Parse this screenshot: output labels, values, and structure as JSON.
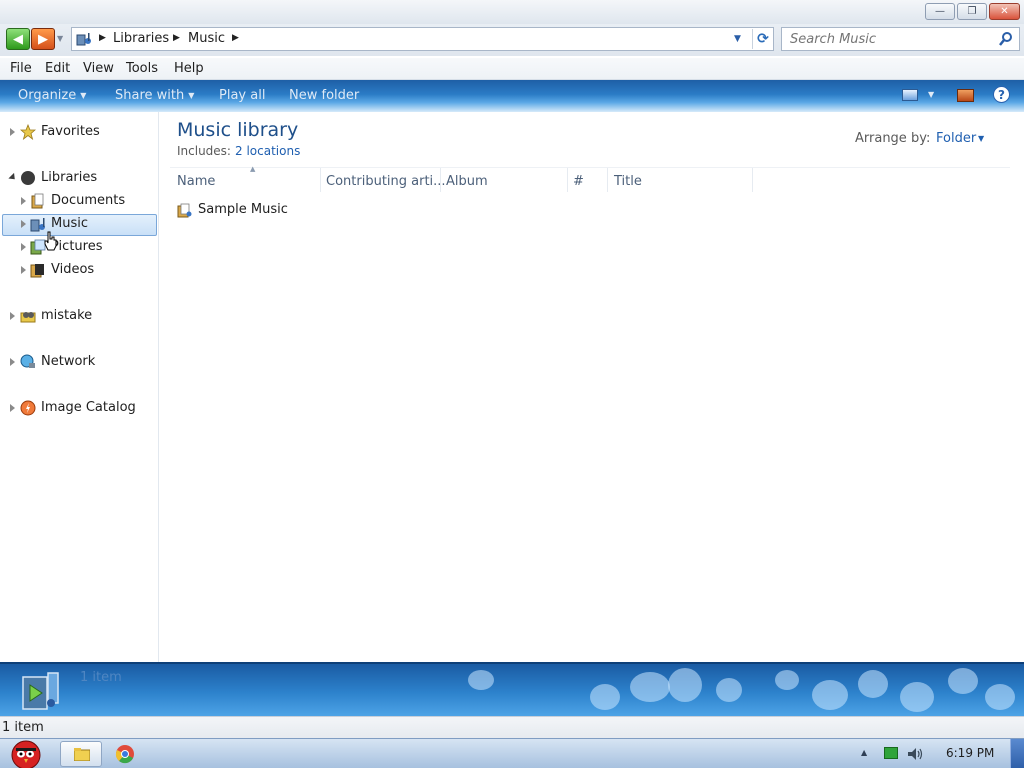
{
  "window": {
    "minimize_glyph": "—",
    "maximize_glyph": "❐",
    "close_glyph": "✕"
  },
  "address": {
    "back_glyph": "◀",
    "forward_glyph": "▶",
    "breadcrumbs": [
      "Libraries",
      "Music"
    ],
    "search_placeholder": "Search Music"
  },
  "menu": [
    "File",
    "Edit",
    "View",
    "Tools",
    "Help"
  ],
  "commandbar": {
    "organize": "Organize",
    "share_with": "Share with",
    "play_all": "Play all",
    "new_folder": "New folder",
    "help_glyph": "?"
  },
  "navpane": {
    "favorites": "Favorites",
    "libraries": "Libraries",
    "documents": "Documents",
    "music": "Music",
    "pictures": "Pictures",
    "videos": "Videos",
    "user": "mistake",
    "network": "Network",
    "image_catalog": "Image Catalog"
  },
  "content": {
    "title": "Music library",
    "includes_label": "Includes:",
    "locations": "2 locations",
    "arrange_label": "Arrange by:",
    "arrange_value": "Folder",
    "columns": [
      "Name",
      "Contributing arti...",
      "Album",
      "#",
      "Title"
    ],
    "rows": [
      {
        "name": "Sample Music"
      }
    ]
  },
  "details": {
    "item_count": "1 item"
  },
  "statusbar": {
    "text": "1 item"
  },
  "taskbar": {
    "clock": "6:19 PM"
  },
  "colors": {
    "accent": "#1f5fb0",
    "title": "#1e4f8a",
    "commandbar": "#2b7cc6"
  },
  "icons": {
    "back": "back-arrow-icon",
    "forward": "forward-arrow-icon",
    "search": "search-icon",
    "refresh": "refresh-icon",
    "help": "help-icon",
    "favorites": "star-icon",
    "libraries": "libraries-icon",
    "network": "network-icon"
  }
}
